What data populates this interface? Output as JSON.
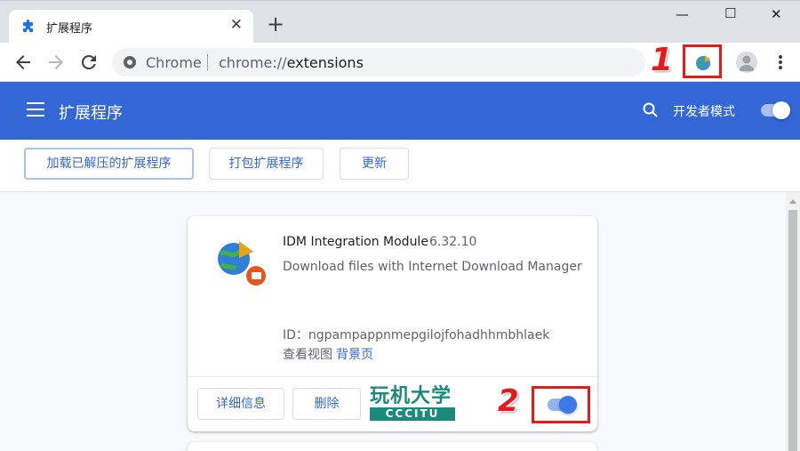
{
  "tab": {
    "title": "扩展程序",
    "close": "✕"
  },
  "newtab": "+",
  "window": {
    "minimize": "—",
    "maximize": "☐",
    "close": "✕"
  },
  "omnibox": {
    "scheme": "Chrome",
    "url_prefix": "chrome://",
    "url_path": "extensions"
  },
  "header": {
    "title": "扩展程序",
    "dev_mode_label": "开发者模式",
    "dev_mode_on": true
  },
  "actions": {
    "load_unpacked": "加载已解压的扩展程序",
    "pack": "打包扩展程序",
    "update": "更新"
  },
  "extension": {
    "name": "IDM Integration Module",
    "version": "6.32.10",
    "description": "Download files with Internet Download Manager",
    "id_text": "ID：ngpampappnmepgilojfohadhhmbhlaek",
    "views_label": "查看视图",
    "views_link": "背景页",
    "details_button": "详细信息",
    "remove_button": "删除",
    "enabled": true
  },
  "annotations": {
    "one": "1",
    "two": "2"
  },
  "watermark": {
    "cn": "玩机大学",
    "en": "CCCITU"
  },
  "colors": {
    "header_blue": "#3367d6",
    "toggle_on": "#3c78e6",
    "annotation_red": "#e51a1a"
  }
}
